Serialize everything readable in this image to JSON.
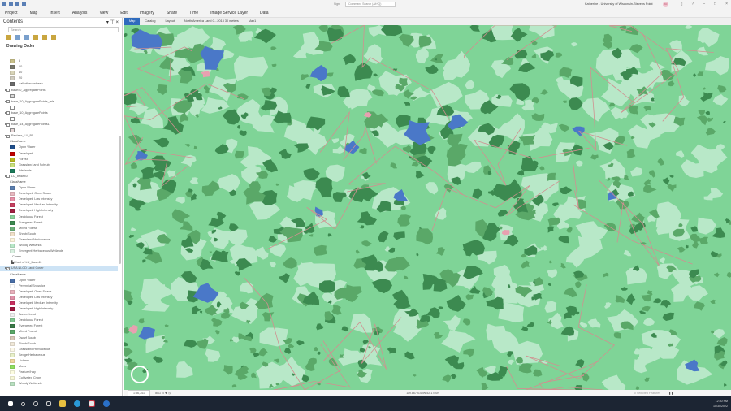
{
  "titlebar": {
    "sign_in": "Sign",
    "search_placeholder": "Command Search (Alt+Q)",
    "user": "Katherine - University of Wisconsin-Stevens Point",
    "avatar": "KC"
  },
  "ribbon": {
    "tabs": [
      "Project",
      "Map",
      "Insert",
      "Analysis",
      "View",
      "Edit",
      "Imagery",
      "Share",
      "Time",
      "Image Service Layer",
      "Data"
    ]
  },
  "contents": {
    "title": "Contents",
    "search_placeholder": "Search",
    "drawing_order": "Drawing Order",
    "top_legend": [
      {
        "label": "5",
        "color": "#c8c08a"
      },
      {
        "label": "10",
        "color": "#7a7a6e"
      },
      {
        "label": "40",
        "color": "#d8d4b8"
      },
      {
        "label": "20",
        "color": "#d0ccc0"
      },
      {
        "label": "<all other values>",
        "color": "#6a6a6a"
      }
    ],
    "layers": [
      {
        "name": "base40_AggregatePoints",
        "color": "#dcdcdc"
      },
      {
        "name": "base_10_AggregatePoints_tele",
        "color": "#ffffff"
      },
      {
        "name": "base_10_AggregatePoints",
        "color": "#ffffff"
      },
      {
        "name": "base_14_AggregatePoints1",
        "color": "#e8d8d8"
      }
    ],
    "reclass": {
      "name": "Reclass_LU_B2",
      "header": "ClassName",
      "items": [
        {
          "label": "Open Water",
          "color": "#1f4e8c"
        },
        {
          "label": "Developed",
          "color": "#c00000"
        },
        {
          "label": "Forest",
          "color": "#b8b820"
        },
        {
          "label": "Grassland and Schrub",
          "color": "#c8e07a"
        },
        {
          "label": "Wetlands",
          "color": "#1a7a5a"
        }
      ]
    },
    "lu": {
      "name": "LU_Base40",
      "header": "ClassName",
      "items": [
        {
          "label": "Open Water",
          "color": "#5b7fb0"
        },
        {
          "label": "Developed Open Space",
          "color": "#e8b8c0"
        },
        {
          "label": "Developed Low Intensity",
          "color": "#e890a8"
        },
        {
          "label": "Developed Medium Intensity",
          "color": "#c84060"
        },
        {
          "label": "Developed High Intensity",
          "color": "#a02040"
        },
        {
          "label": "Deciduous Forest",
          "color": "#8cd49c"
        },
        {
          "label": "Evergreen Forest",
          "color": "#3c8a50"
        },
        {
          "label": "Mixed Forest",
          "color": "#6cb07a"
        },
        {
          "label": "Shrub/Scrub",
          "color": "#f0e0c8"
        },
        {
          "label": "Grassland/Herbaceous",
          "color": "#fdf5dc"
        },
        {
          "label": "Woody Wetlands",
          "color": "#b8e8c8"
        },
        {
          "label": "Emergent Herbaceous Wetlands",
          "color": "#d8f0e0"
        }
      ]
    },
    "charts_label": "Charts",
    "chart_item": "Chart of LU_Base40",
    "usa": {
      "name": "USA NLCD Land Cover",
      "header": "ClassName",
      "items": [
        {
          "label": "Open Water",
          "color": "#4a6fa8"
        },
        {
          "label": "Perennial Snow/Ice",
          "color": "#ffffff"
        },
        {
          "label": "Developed Open Space",
          "color": "#e8b0bc"
        },
        {
          "label": "Developed Low Intensity",
          "color": "#e090a8"
        },
        {
          "label": "Developed Medium Intensity",
          "color": "#c83060"
        },
        {
          "label": "Developed High Intensity",
          "color": "#a01840"
        },
        {
          "label": "Barren Land",
          "color": "#f0f0f0"
        },
        {
          "label": "Deciduous Forest",
          "color": "#80c890"
        },
        {
          "label": "Evergreen Forest",
          "color": "#3a7a48"
        },
        {
          "label": "Mixed Forest",
          "color": "#5aa868"
        },
        {
          "label": "Dwarf Scrub",
          "color": "#d8c8b8"
        },
        {
          "label": "Shrub/Scrub",
          "color": "#f0e8d8"
        },
        {
          "label": "Grassland/Herbaceous",
          "color": "#fcf8e8"
        },
        {
          "label": "Sedge/Herbaceous",
          "color": "#e8f0c8"
        },
        {
          "label": "Lichens",
          "color": "#f0d8a0"
        },
        {
          "label": "Moss",
          "color": "#90e060"
        },
        {
          "label": "Pasture/Hay",
          "color": "#fcfce0"
        },
        {
          "label": "Cultivated Crops",
          "color": "#f8f8d8"
        },
        {
          "label": "Woody Wetlands",
          "color": "#b8e0c0"
        }
      ]
    }
  },
  "map_tabs": [
    "Map",
    "Catalog",
    "Layout",
    "North America Land C...2015 30 meters",
    "Map1"
  ],
  "status": {
    "scale": "1:86,741",
    "coords": "119.8679140W 52.1750N",
    "selected": "0 Selected Features"
  },
  "taskbar": {
    "time": "12:40 PM",
    "date": "10/30/2022"
  },
  "map_colors": {
    "base": "#7fd497",
    "forest": "#3c8a50",
    "mixed": "#5aa868",
    "wetland": "#b8e8c8",
    "water": "#4a78c8",
    "developed": "#e8a0b0",
    "road": "#d09090"
  }
}
